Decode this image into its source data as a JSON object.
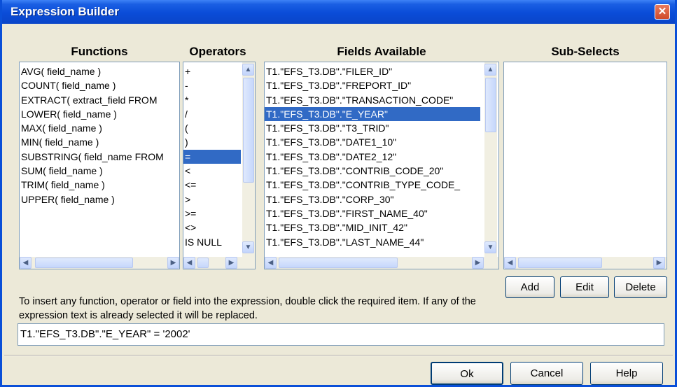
{
  "window": {
    "title": "Expression Builder",
    "close_icon": "close-icon"
  },
  "columns": {
    "functions": "Functions",
    "operators": "Operators",
    "fields": "Fields Available",
    "subselects": "Sub-Selects"
  },
  "functions": [
    "AVG( field_name )",
    "COUNT( field_name )",
    "EXTRACT( extract_field FROM",
    "LOWER( field_name )",
    "MAX( field_name )",
    "MIN( field_name )",
    "SUBSTRING( field_name FROM",
    "SUM( field_name )",
    "TRIM( field_name )",
    "UPPER( field_name )"
  ],
  "operators": [
    "+",
    "-",
    "*",
    "/",
    "(",
    ")",
    "=",
    "<",
    "<=",
    ">",
    ">=",
    "<>",
    "IS NULL"
  ],
  "operators_selected": "=",
  "fields": [
    "T1.\"EFS_T3.DB\".\"FILER_ID\"",
    "T1.\"EFS_T3.DB\".\"FREPORT_ID\"",
    "T1.\"EFS_T3.DB\".\"TRANSACTION_CODE\"",
    "T1.\"EFS_T3.DB\".\"E_YEAR\"",
    "T1.\"EFS_T3.DB\".\"T3_TRID\"",
    "T1.\"EFS_T3.DB\".\"DATE1_10\"",
    "T1.\"EFS_T3.DB\".\"DATE2_12\"",
    "T1.\"EFS_T3.DB\".\"CONTRIB_CODE_20\"",
    "T1.\"EFS_T3.DB\".\"CONTRIB_TYPE_CODE_",
    "T1.\"EFS_T3.DB\".\"CORP_30\"",
    "T1.\"EFS_T3.DB\".\"FIRST_NAME_40\"",
    "T1.\"EFS_T3.DB\".\"MID_INIT_42\"",
    "T1.\"EFS_T3.DB\".\"LAST_NAME_44\""
  ],
  "fields_selected": "T1.\"EFS_T3.DB\".\"E_YEAR\"",
  "subselect_buttons": {
    "add": "Add",
    "edit": "Edit",
    "delete": "Delete"
  },
  "instructions": "To insert any function, operator or field into the expression, double click the required item. If any of the expression text is already selected it will be replaced.",
  "expression": {
    "value": "T1.\"EFS_T3.DB\".\"E_YEAR\" = '2002'"
  },
  "footer": {
    "ok": "Ok",
    "cancel": "Cancel",
    "help": "Help"
  },
  "scroll_glyphs": {
    "up": "▲",
    "down": "▼",
    "left": "◀",
    "right": "▶"
  },
  "colors": {
    "selection": "#316ac5",
    "titlebar": "#0a4cd8",
    "dialog_bg": "#ece9d8"
  }
}
